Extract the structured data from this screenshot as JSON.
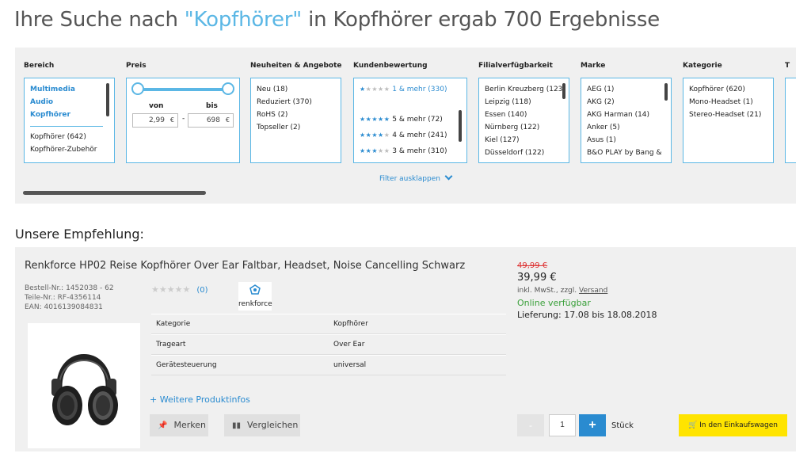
{
  "search": {
    "prefix": "Ihre Suche nach ",
    "query": "\"Kopfhörer\"",
    "suffix": " in Kopfhörer ergab 700 Ergebnisse"
  },
  "filters": {
    "bereich": {
      "title": "Bereich",
      "selected": [
        "Multimedia",
        "Audio",
        "Kopfhörer"
      ],
      "options": [
        "Kopfhörer (642)",
        "Kopfhörer-Zubehör"
      ]
    },
    "preis": {
      "title": "Preis",
      "from_label": "von",
      "to_label": "bis",
      "from_value": "2,99",
      "to_value": "698",
      "currency": "€",
      "dash": "-"
    },
    "neuheiten": {
      "title": "Neuheiten & Angebote",
      "options": [
        "Neu (18)",
        "Reduziert (370)",
        "RoHS (2)",
        "Topseller (2)"
      ]
    },
    "kundenbewertung": {
      "title": "Kundenbewertung",
      "options": [
        {
          "stars": 1,
          "label": "1 & mehr (330)"
        },
        {
          "stars": 5,
          "label": "5 & mehr (72)"
        },
        {
          "stars": 4,
          "label": "4 & mehr (241)"
        },
        {
          "stars": 3,
          "label": "3 & mehr (310)"
        }
      ]
    },
    "filialen": {
      "title": "Filialverfügbarkeit",
      "options": [
        "Berlin Kreuzberg (123)",
        "Leipzig (118)",
        "Essen (140)",
        "Nürnberg (122)",
        "Kiel (127)",
        "Düsseldorf (122)"
      ]
    },
    "marke": {
      "title": "Marke",
      "options": [
        "AEG (1)",
        "AKG (2)",
        "AKG Harman (14)",
        "Anker (5)",
        "Asus (1)",
        "B&O PLAY by Bang &"
      ]
    },
    "kategorie": {
      "title": "Kategorie",
      "options": [
        "Kopfhörer (620)",
        "Mono-Headset (1)",
        "Stereo-Headset (21)"
      ]
    },
    "next_title": "T",
    "expand_label": "Filter ausklappen"
  },
  "recommendation": {
    "heading": "Unsere Empfehlung:",
    "product": {
      "title": "Renkforce HP02 Reise Kopfhörer Over Ear Faltbar, Headset, Noise Cancelling Schwarz",
      "order_no": "Bestell-Nr.: 1452038 - 62",
      "part_no": "Teile-Nr.: RF-4356114",
      "ean": "EAN: 4016139084831",
      "rating_count": "(0)",
      "brand": "renkforce",
      "attributes": [
        {
          "key": "Kategorie",
          "value": "Kopfhörer"
        },
        {
          "key": "Trageart",
          "value": "Over Ear"
        },
        {
          "key": "Gerätesteuerung",
          "value": "universal"
        }
      ],
      "more_info": "+ Weitere Produktinfos",
      "merken": "Merken",
      "vergleichen": "Vergleichen",
      "price_old": "49,99 €",
      "price_new": "39,99 €",
      "vat_text": "inkl. MwSt., zzgl. ",
      "vat_link": "Versand",
      "availability": "Online verfügbar",
      "delivery": "Lieferung: 17.08 bis 18.08.2018",
      "qty_minus": "-",
      "qty": "1",
      "qty_plus": "+",
      "unit": "Stück",
      "cart": "In den Einkaufswagen"
    }
  },
  "colors": {
    "accent": "#5bb7e5",
    "link": "#2a8bd0",
    "cart": "#ffe400",
    "available": "#3aa03a",
    "old_price": "#dd3333"
  }
}
